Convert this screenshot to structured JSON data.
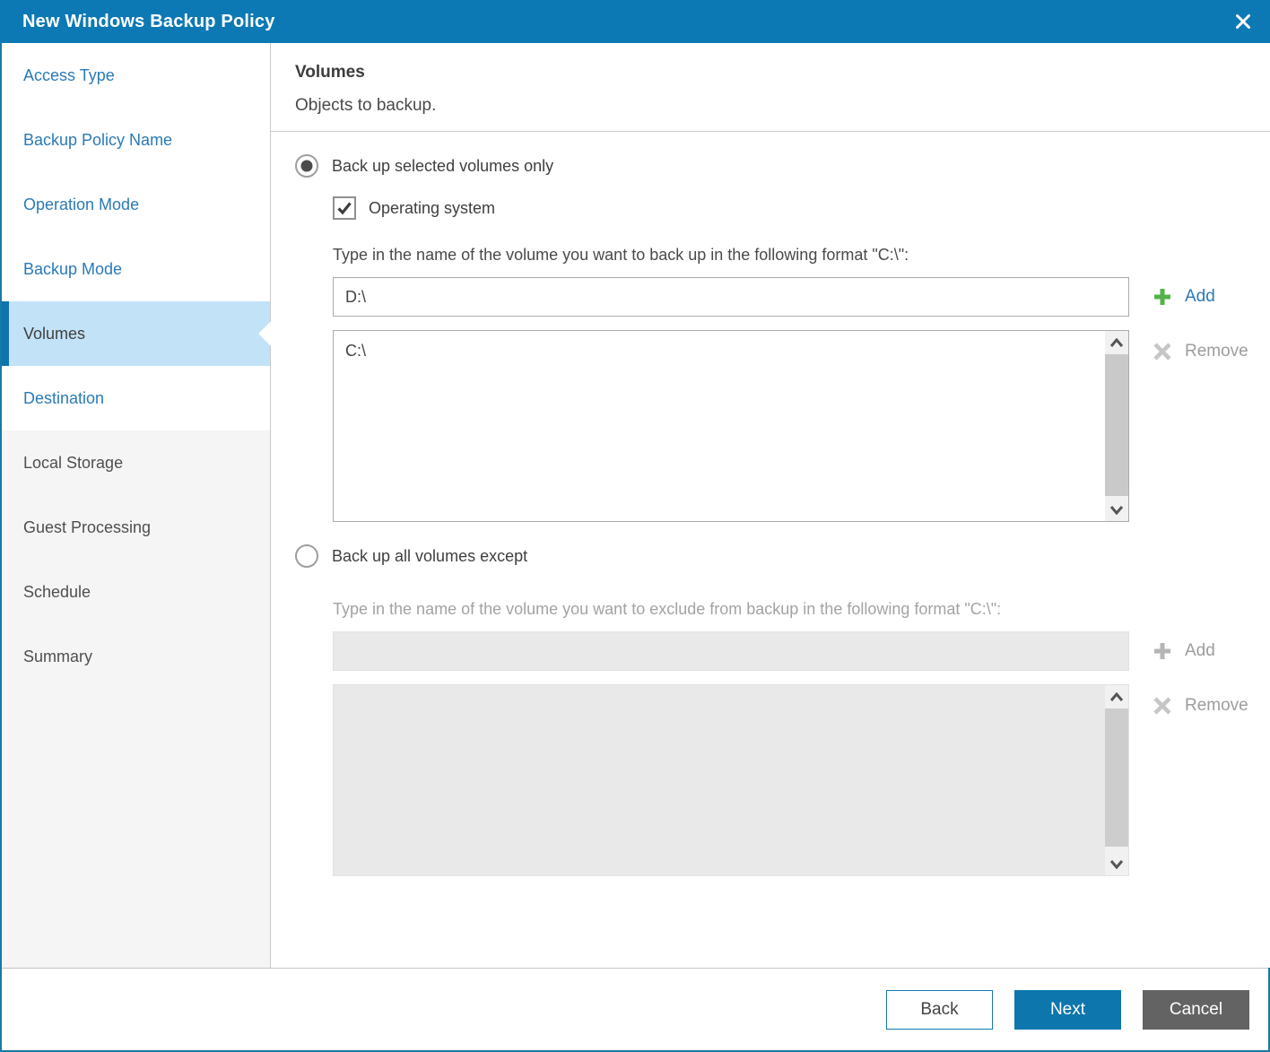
{
  "dialog": {
    "title": "New Windows Backup Policy",
    "close_icon": "close-x"
  },
  "sidebar": {
    "items": [
      {
        "label": "Access Type",
        "state": "enabled"
      },
      {
        "label": "Backup Policy Name",
        "state": "enabled"
      },
      {
        "label": "Operation Mode",
        "state": "enabled"
      },
      {
        "label": "Backup Mode",
        "state": "enabled"
      },
      {
        "label": "Volumes",
        "state": "current"
      },
      {
        "label": "Destination",
        "state": "enabled"
      },
      {
        "label": "Local Storage",
        "state": "disabled"
      },
      {
        "label": "Guest Processing",
        "state": "disabled"
      },
      {
        "label": "Schedule",
        "state": "disabled"
      },
      {
        "label": "Summary",
        "state": "disabled"
      }
    ]
  },
  "content": {
    "title": "Volumes",
    "subtitle": "Objects to backup.",
    "include": {
      "radio_label": "Back up selected volumes only",
      "radio_selected": true,
      "os_checkbox_label": "Operating system",
      "os_checkbox_checked": true,
      "input_hint": "Type in the name of the volume you want to back up in the following format \"C:\\\":",
      "input_value": "D:\\",
      "add_label": "Add",
      "remove_label": "Remove",
      "volumes": [
        "C:\\"
      ]
    },
    "exclude": {
      "radio_label": "Back up all volumes except",
      "radio_selected": false,
      "input_hint": "Type in the name of the volume you want to exclude from backup in the following format \"C:\\\":",
      "input_value": "",
      "add_label": "Add",
      "remove_label": "Remove",
      "volumes": []
    }
  },
  "footer": {
    "back_label": "Back",
    "next_label": "Next",
    "cancel_label": "Cancel"
  },
  "colors": {
    "titlebar_blue": "#0d79b4",
    "link_blue": "#2a7ab7",
    "selected_step_bg": "#c2e2f7",
    "accent_bar": "#0d74ac",
    "add_green": "#54b14a",
    "disabled_gray": "#9d9d9d",
    "next_button_blue": "#0d76ad",
    "cancel_button_gray": "#636363"
  }
}
